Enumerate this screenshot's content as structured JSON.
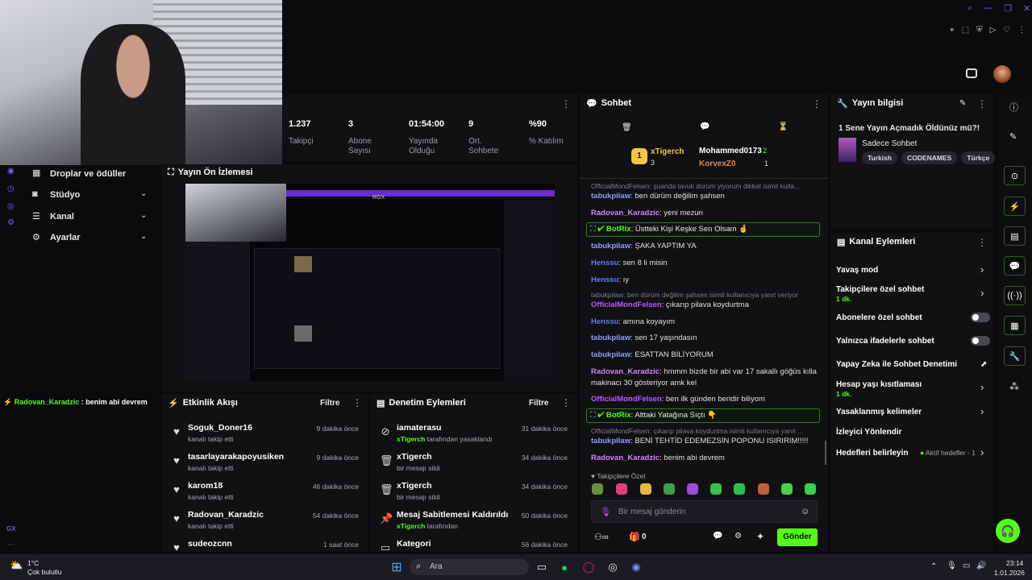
{
  "colors": {
    "accent": "#53fc18",
    "panel": "#111114",
    "background": "#0b0b0d"
  },
  "sidebar": {
    "items": [
      {
        "label": "Droplar ve ödüller",
        "icon": "gift-icon"
      },
      {
        "label": "Stüdyo",
        "icon": "camera-icon"
      },
      {
        "label": "Kanal",
        "icon": "list-icon"
      },
      {
        "label": "Ayarlar",
        "icon": "gear-icon"
      }
    ],
    "footer_text": "GX",
    "feed_user": "Radovan_Karadzic",
    "feed_text": ": benim abi devrem"
  },
  "stats": [
    {
      "value": "1.237",
      "label": "Takipçi"
    },
    {
      "value": "3",
      "label": "Abone Sayısı"
    },
    {
      "value": "01:54:00",
      "label": "Yayında Olduğu"
    },
    {
      "value": "9",
      "label": "Ort. Sohbete"
    },
    {
      "value": "%90",
      "label": "% Katılım"
    }
  ],
  "preview": {
    "title": "Yayın Ön İzlemesi",
    "overlay": "RGX"
  },
  "events": {
    "title": "Etkinlik Akışı",
    "filter": "Filtre",
    "items": [
      {
        "name": "Soguk_Doner16",
        "sub": "kanalı takip etti",
        "time": "9 dakika önce"
      },
      {
        "name": "tasarlayarakapoyusiken",
        "sub": "kanalı takip etti",
        "time": "9 dakika önce"
      },
      {
        "name": "karom18",
        "sub": "kanalı takip etti",
        "time": "46 dakika önce"
      },
      {
        "name": "Radovan_Karadzic",
        "sub": "kanalı takip etti",
        "time": "54 dakika önce"
      },
      {
        "name": "sudeozcnn",
        "sub": "",
        "time": "1 saat önce"
      }
    ]
  },
  "moderation": {
    "title": "Denetim Eylemleri",
    "filter": "Filtre",
    "items": [
      {
        "name": "iamaterasu",
        "actor": "xTigerch",
        "sub": " tarafından yasaklandı",
        "time": "31 dakika önce",
        "icon": "ban-icon"
      },
      {
        "name": "xTigerch",
        "actor": "",
        "sub": "bir mesajı sildi",
        "time": "34 dakika önce",
        "icon": "trash-icon"
      },
      {
        "name": "xTigerch",
        "actor": "",
        "sub": "bir mesajı sildi",
        "time": "34 dakika önce",
        "icon": "trash-icon"
      },
      {
        "name": "Mesaj Sabitlemesi Kaldırıldı",
        "actor": "xTigerch",
        "sub": " tarafından",
        "time": "50 dakika önce",
        "icon": "pin-icon"
      },
      {
        "name": "Kategori",
        "actor": "",
        "sub": "",
        "time": "56 dakika önce",
        "icon": "category-icon"
      }
    ]
  },
  "chat": {
    "title": "Sohbet",
    "leaders": {
      "first_rank": "1",
      "first_name": "xTigerch",
      "first_count": "3",
      "second_name": "Mohammed0173",
      "second_count": "2",
      "third_name": "KorvexZ0",
      "third_count": "1"
    },
    "truncated_top": "OfficialMondFelsen: şuanda tavuk dürüm yiyorum dikkat isimli kulla...",
    "messages": [
      {
        "user": "tabukpilaw",
        "text": ": ben dürüm değilim şahsen",
        "color": "#8f9bff"
      },
      {
        "user": "Radovan_Karadzic",
        "text": ": yeni mezun",
        "color": "#d085ff"
      },
      {
        "user": "tabukpilaw",
        "text": ": ŞAKA YAPTIM YA",
        "color": "#8f9bff"
      },
      {
        "user": "Henssu",
        "text": ": sen 8 li misin",
        "color": "#5b7bff"
      },
      {
        "user": "Henssu",
        "text": ": ıy",
        "color": "#5b7bff"
      },
      {
        "user": "OfficialMondFelsen",
        "text": ": çıkarıp pilava koydurtma",
        "color": "#b45cff"
      },
      {
        "user": "Henssu",
        "text": ": amına koyayım",
        "color": "#5b7bff"
      },
      {
        "user": "tabukpilaw",
        "text": ": sen 17 yaşındasın",
        "color": "#8f9bff"
      },
      {
        "user": "tabukpilaw",
        "text": ": ESATTAN BİLİYORUM",
        "color": "#8f9bff"
      },
      {
        "user": "Radovan_Karadzic",
        "text": ": hmmm bizde bir abi var 17 sakallı göğüs kılla",
        "color": "#d085ff"
      },
      {
        "user": "",
        "text": "makinacı 30 gösteriyor amk kel",
        "color": "#e0e0e0"
      },
      {
        "user": "OfficialMondFelsen",
        "text": ": ben ilk günden beridir biliyom",
        "color": "#b45cff"
      },
      {
        "user": "tabukpilaw",
        "text": ": BENİ TEHTİD EDEMEZSİN POPONU ISIRIRIM!!!!!",
        "color": "#8f9bff"
      },
      {
        "user": "Radovan_Karadzic",
        "text": ": benim abi devrem",
        "color": "#d085ff"
      }
    ],
    "reply1": "tabukpilaw: ben dürüm değilim şahsen isimli kullanıcıya yanıt veriyor",
    "reply2": "OfficialMondFelsen: çıkarıp pilava koydurtma isimli kullanıcıya yanıt ...",
    "bot1_user": "BotRix",
    "bot1_text": ": Üstteki Kişi Keşke Sen Olsam 🤞",
    "bot2_user": "BotRix",
    "bot2_text": ": Alttaki Yatağına Sıçtı 👇",
    "emote_label": "Takipçilere Özel",
    "input_placeholder": "Bir mesaj gönderin",
    "count": "0",
    "send": "Gönder"
  },
  "stream_info": {
    "title": "Yayın bilgisi",
    "stream_title": "1 Sene Yayın Açmadık Öldünüz mü?!",
    "category": "Sadece Sohbet",
    "tags": [
      "Turkish",
      "CODENAMES",
      "Türkçe"
    ]
  },
  "channel_actions": {
    "title": "Kanal Eylemleri",
    "items": [
      {
        "label": "Yavaş mod",
        "sub": "",
        "control": "chevron"
      },
      {
        "label": "Takipçilere özel sohbet",
        "sub": "1 dk.",
        "control": "chevron"
      },
      {
        "label": "Abonelere özel sohbet",
        "sub": "",
        "control": "toggle"
      },
      {
        "label": "Yalnızca ifadelerle sohbet",
        "sub": "",
        "control": "toggle"
      },
      {
        "label": "Yapay Zeka ile Sohbet Denetimi",
        "sub": "",
        "control": "external"
      },
      {
        "label": "Hesap yaşı kısıtlaması",
        "sub": "1 dk.",
        "control": "chevron"
      },
      {
        "label": "Yasaklanmış kelimeler",
        "sub": "",
        "control": "chevron"
      },
      {
        "label": "İzleyici Yönlendir",
        "sub": "",
        "control": "none"
      },
      {
        "label": "Hedefleri belirleyin",
        "sub": "",
        "control": "chevron"
      }
    ],
    "goals_badge": "Aktif hedefler - 1"
  },
  "taskbar": {
    "weather_temp": "1°C",
    "weather_text": "Çok bulutlu",
    "search": "Ara",
    "time": "23:14",
    "date": "1.01.2026"
  }
}
